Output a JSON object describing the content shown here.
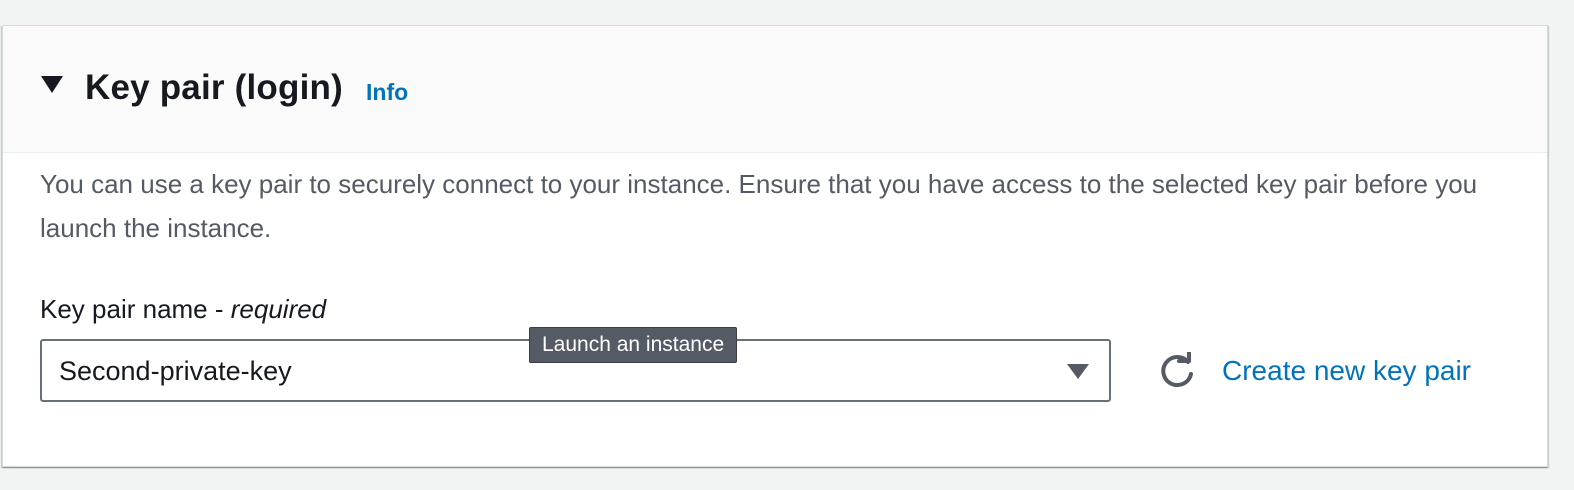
{
  "section": {
    "title": "Key pair (login)",
    "info_label": "Info",
    "expanded": true,
    "description": "You can use a key pair to securely connect to your instance. Ensure that you have access to the selected key pair before you launch the instance."
  },
  "key_pair_field": {
    "label": "Key pair name - ",
    "required_label": "required",
    "selected_value": "Second-private-key",
    "dropdown_icon": "caret-down-icon"
  },
  "tooltip": {
    "text": "Launch an instance"
  },
  "actions": {
    "refresh_icon": "refresh-icon",
    "create_label": "Create new key pair"
  },
  "colors": {
    "link": "#0073bb",
    "text": "#16191f",
    "secondary_text": "#545b64",
    "border": "#687078",
    "page_background": "#f2f3f3"
  }
}
